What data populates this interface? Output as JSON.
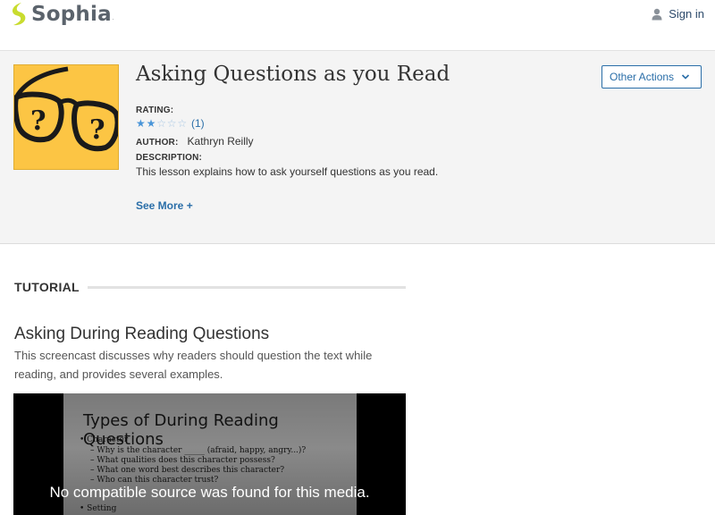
{
  "header": {
    "logo_text": "Sophia",
    "logo_tm": ".",
    "signin_label": "Sign in",
    "icons": [
      "sophia-logo-icon",
      "user-icon"
    ]
  },
  "lesson": {
    "title": "Asking Questions as you Read",
    "other_actions_label": "Other Actions",
    "rating_label": "RATING:",
    "rating_value": 2,
    "rating_max": 5,
    "rating_count": "(1)",
    "author_label": "AUTHOR:",
    "author_name": "Kathryn Reilly",
    "description_label": "DESCRIPTION:",
    "description": "This lesson explains how to ask yourself questions as you read.",
    "see_more_label": "See More +"
  },
  "tutorial": {
    "section_label": "TUTORIAL",
    "title": "Asking During Reading Questions",
    "description": "This screencast discusses why readers should question the text while reading, and provides several examples."
  },
  "video": {
    "slide_title": "Types of During Reading Questions",
    "bullets": [
      "• Character",
      "– Why is the character _____ (afraid, happy, angry...)?",
      "– What qualities does this character possess?",
      "– What one word best describes this character?",
      "– Who can this character trust?",
      "• Setting"
    ],
    "error_message": "No compatible source was found for this media."
  },
  "colors": {
    "accent_blue": "#2a6ea8",
    "logo_green": "#c9dc2f",
    "thumbnail_yellow": "#fcc544"
  }
}
